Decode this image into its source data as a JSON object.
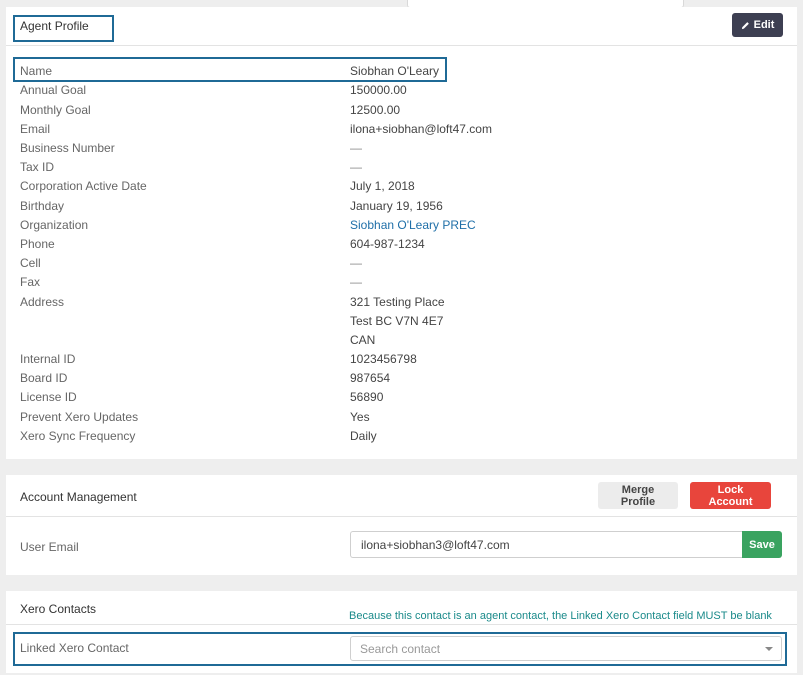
{
  "profile": {
    "title": "Agent Profile",
    "edit_label": "Edit",
    "fields": [
      {
        "label": "Name",
        "value": "Siobhan O'Leary"
      },
      {
        "label": "Annual Goal",
        "value": "150000.00"
      },
      {
        "label": "Monthly Goal",
        "value": "12500.00"
      },
      {
        "label": "Email",
        "value": "ilona+siobhan@loft47.com"
      },
      {
        "label": "Business Number",
        "value": "—"
      },
      {
        "label": "Tax ID",
        "value": "—"
      },
      {
        "label": "Corporation Active Date",
        "value": "July 1, 2018"
      },
      {
        "label": "Birthday",
        "value": "January 19, 1956"
      },
      {
        "label": "Organization",
        "value": "Siobhan O'Leary PREC"
      },
      {
        "label": "Phone",
        "value": "604-987-1234"
      },
      {
        "label": "Cell",
        "value": "—"
      },
      {
        "label": "Fax",
        "value": "—"
      },
      {
        "label": "Address",
        "lines": [
          "321 Testing Place",
          "Test BC V7N 4E7",
          "CAN"
        ]
      },
      {
        "label": "Internal ID",
        "value": "1023456798"
      },
      {
        "label": "Board ID",
        "value": "987654"
      },
      {
        "label": "License ID",
        "value": "56890"
      },
      {
        "label": "Prevent Xero Updates",
        "value": "Yes"
      },
      {
        "label": "Xero Sync Frequency",
        "value": "Daily"
      }
    ]
  },
  "account": {
    "title": "Account Management",
    "merge_label": "Merge Profile",
    "lock_label": "Lock Account",
    "user_email_label": "User Email",
    "user_email_value": "ilona+siobhan3@loft47.com",
    "save_label": "Save"
  },
  "xero": {
    "title": "Xero Contacts",
    "notice": "Because this contact is an agent contact, the Linked Xero Contact field MUST be blank",
    "linked_label": "Linked Xero Contact",
    "search_placeholder": "Search contact"
  },
  "colors": {
    "edit_button": "#3d3f52",
    "lock_button": "#e8453c",
    "save_button": "#3aa360",
    "link": "#1f6fa8",
    "annotation": "#1f6a96",
    "notice_text": "#1a8a8a"
  },
  "icons": {
    "edit": "pencil-icon",
    "dropdown": "chevron-down-icon"
  }
}
